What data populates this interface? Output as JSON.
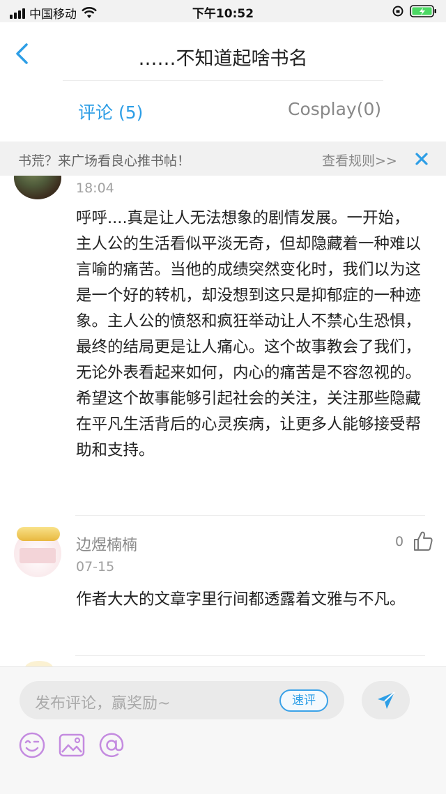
{
  "status_bar": {
    "carrier": "中国移动",
    "time": "下午10:52"
  },
  "nav": {
    "title": "……不知道起啥书名"
  },
  "tabs": [
    {
      "label": "评论 (5)",
      "active": true
    },
    {
      "label": "Cosplay(0)",
      "active": false
    }
  ],
  "notice": {
    "text": "书荒？来广场看良心推书帖！",
    "rules_link": "查看规则>>"
  },
  "comments": [
    {
      "time": "18:04",
      "body": "呼呼....真是让人无法想象的剧情发展。一开始，主人公的生活看似平淡无奇，但却隐藏着一种难以言喻的痛苦。当他的成绩突然变化时，我们以为这是一个好的转机，却没想到这只是抑郁症的一种迹象。主人公的愤怒和疯狂举动让人不禁心生恐惧，最终的结局更是让人痛心。这个故事教会了我们，无论外表看起来如何，内心的痛苦是不容忽视的。希望这个故事能够引起社会的关注，关注那些隐藏在平凡生活背后的心灵疾病，让更多人能够接受帮助和支持。"
    },
    {
      "name": "边煜楠楠",
      "time": "07-15",
      "likes": "0",
      "body": "作者大大的文章字里行间都透露着文雅与不凡。"
    }
  ],
  "composer": {
    "placeholder": "发布评论，赢奖励~",
    "quick_label": "速评"
  },
  "colors": {
    "accent": "#2d9ee6",
    "tool_icon": "#c48be0"
  },
  "icons": [
    "back-arrow-icon",
    "close-icon",
    "like-icon",
    "send-icon",
    "emoji-icon",
    "image-icon",
    "at-icon"
  ]
}
